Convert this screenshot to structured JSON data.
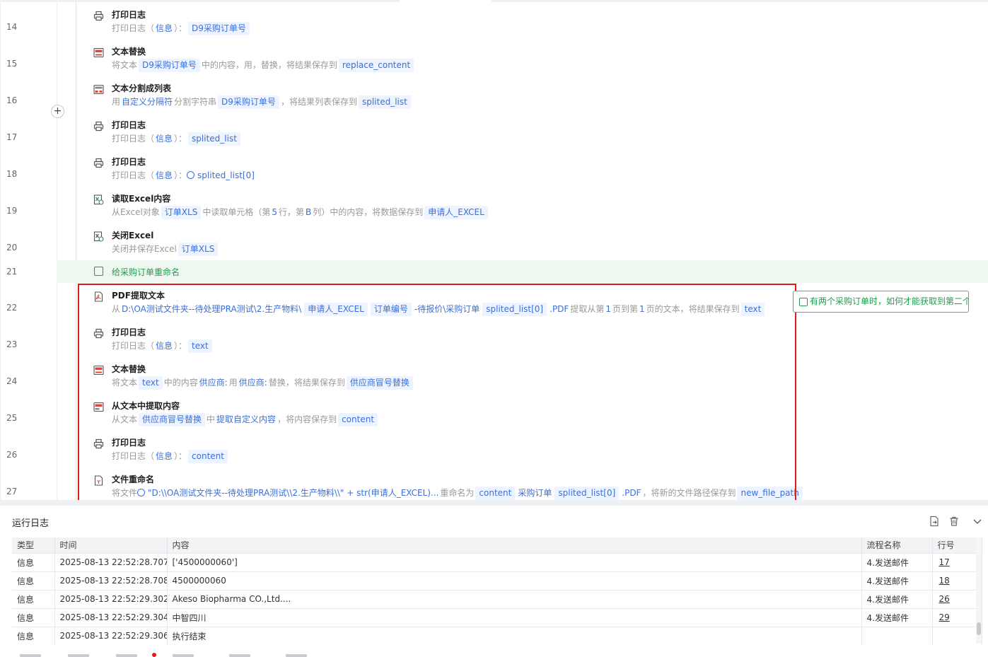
{
  "steps": [
    {
      "line": "14",
      "title": "打印日志",
      "icon": "printer-icon",
      "desc": [
        [
          "p",
          "打印日志（"
        ],
        [
          "l",
          "信息"
        ],
        [
          "p",
          "）："
        ],
        [
          "t",
          "D9采购订单号"
        ]
      ]
    },
    {
      "line": "15",
      "title": "文本替换",
      "icon": "text-replace-icon",
      "desc": [
        [
          "p",
          "将文本"
        ],
        [
          "t",
          "D9采购订单号"
        ],
        [
          "p",
          "中的内容，用，替换，将结果保存到"
        ],
        [
          "t",
          "replace_content"
        ]
      ]
    },
    {
      "line": "16",
      "title": "文本分割成列表",
      "icon": "text-split-icon",
      "desc": [
        [
          "p",
          "用"
        ],
        [
          "l",
          "自定义分隔符"
        ],
        [
          "p",
          "分割字符串"
        ],
        [
          "t",
          "D9采购订单号"
        ],
        [
          "p",
          "，将结果列表保存到"
        ],
        [
          "t",
          "splited_list"
        ]
      ]
    },
    {
      "line": "17",
      "title": "打印日志",
      "icon": "printer-icon",
      "desc": [
        [
          "p",
          "打印日志（"
        ],
        [
          "l",
          "信息"
        ],
        [
          "p",
          "）："
        ],
        [
          "t",
          "splited_list"
        ]
      ]
    },
    {
      "line": "18",
      "title": "打印日志",
      "icon": "printer-icon",
      "desc": [
        [
          "p",
          "打印日志（"
        ],
        [
          "l",
          "信息"
        ],
        [
          "p",
          "）："
        ],
        [
          "v",
          "splited_list[0]"
        ]
      ]
    },
    {
      "line": "19",
      "title": "读取Excel内容",
      "icon": "excel-read-icon",
      "desc": [
        [
          "p",
          "从Excel对象"
        ],
        [
          "t",
          "订单XLS"
        ],
        [
          "p",
          "中读取单元格（第"
        ],
        [
          "l",
          "5"
        ],
        [
          "p",
          "行，第"
        ],
        [
          "l",
          "B"
        ],
        [
          "p",
          "列）中的内容，将数据保存到"
        ],
        [
          "t",
          "申请人_EXCEL"
        ]
      ]
    },
    {
      "line": "20",
      "title": "关闭Excel",
      "icon": "excel-close-icon",
      "desc": [
        [
          "p",
          "关闭并保存Excel"
        ],
        [
          "t",
          "订单XLS"
        ]
      ]
    },
    {
      "line": "22",
      "title": "PDF提取文本",
      "icon": "pdf-icon",
      "desc": [
        [
          "p",
          "从"
        ],
        [
          "l",
          "D:\\OA测试文件夹--待处理PRA测试\\2.生产物料\\"
        ],
        [
          "t",
          "申请人_EXCEL"
        ],
        [
          "t",
          "订单编号"
        ],
        [
          "l",
          "-待报价\\采购订单"
        ],
        [
          "t",
          "splited_list[0]"
        ],
        [
          "l",
          ".PDF"
        ],
        [
          "p",
          "提取从第"
        ],
        [
          "l",
          "1"
        ],
        [
          "p",
          "页到第"
        ],
        [
          "l",
          "1"
        ],
        [
          "p",
          "页的文本，将结果保存到"
        ],
        [
          "t",
          "text"
        ]
      ]
    },
    {
      "line": "23",
      "title": "打印日志",
      "icon": "printer-icon",
      "desc": [
        [
          "p",
          "打印日志（"
        ],
        [
          "l",
          "信息"
        ],
        [
          "p",
          "）："
        ],
        [
          "t",
          "text"
        ]
      ]
    },
    {
      "line": "24",
      "title": "文本替换",
      "icon": "text-replace-icon",
      "desc": [
        [
          "p",
          "将文本"
        ],
        [
          "t",
          "text"
        ],
        [
          "p",
          "中的内容"
        ],
        [
          "l",
          "供应商:"
        ],
        [
          "p",
          "用"
        ],
        [
          "l",
          "供应商:"
        ],
        [
          "p",
          "替换，将结果保存到"
        ],
        [
          "t",
          "供应商冒号替换"
        ]
      ]
    },
    {
      "line": "25",
      "title": "从文本中提取内容",
      "icon": "text-extract-icon",
      "desc": [
        [
          "p",
          "从文本"
        ],
        [
          "t",
          "供应商冒号替换"
        ],
        [
          "p",
          "中"
        ],
        [
          "l",
          "提取自定义内容"
        ],
        [
          "p",
          "，将内容保存到"
        ],
        [
          "t",
          "content"
        ]
      ]
    },
    {
      "line": "26",
      "title": "打印日志",
      "icon": "printer-icon",
      "desc": [
        [
          "p",
          "打印日志（"
        ],
        [
          "l",
          "信息"
        ],
        [
          "p",
          "）："
        ],
        [
          "t",
          "content"
        ]
      ]
    },
    {
      "line": "27",
      "title": "文件重命名",
      "icon": "file-rename-icon",
      "desc": [
        [
          "p",
          "将文件"
        ],
        [
          "v",
          "\"D:\\\\OA测试文件夹--待处理PRA测试\\\\2.生产物料\\\\\" + str(申请人_EXCEL)..."
        ],
        [
          "p",
          "重命名为"
        ],
        [
          "t",
          "content"
        ],
        [
          "l",
          "采购订单"
        ],
        [
          "t",
          "splited_list[0]"
        ],
        [
          "l",
          ".PDF"
        ],
        [
          "p",
          "，将新的文件路径保存到"
        ],
        [
          "t",
          "new_file_path"
        ]
      ]
    }
  ],
  "comment": {
    "line": "21",
    "text": "给采购订单重命名"
  },
  "note": {
    "text": "有两个采购订单时，如何才能获取到第二个"
  },
  "log": {
    "title": "运行日志",
    "columns": [
      "类型",
      "时间",
      "内容",
      "流程名称",
      "行号"
    ],
    "rows": [
      {
        "type": "信息",
        "time": "2025-08-13 22:52:28.707",
        "content": "['4500000060']",
        "flow": "4.发送邮件",
        "line": "17"
      },
      {
        "type": "信息",
        "time": "2025-08-13 22:52:28.708",
        "content": "4500000060",
        "flow": "4.发送邮件",
        "line": "18"
      },
      {
        "type": "信息",
        "time": "2025-08-13 22:52:29.302",
        "content": "Akeso Biopharma CO.,Ltd....",
        "flow": "4.发送邮件",
        "line": "26"
      },
      {
        "type": "信息",
        "time": "2025-08-13 22:52:29.304",
        "content": " 中智四川",
        "flow": "4.发送邮件",
        "line": "29"
      },
      {
        "type": "信息",
        "time": "2025-08-13 22:52:29.306",
        "content": "执行结束",
        "flow": "",
        "line": ""
      }
    ]
  },
  "colors": {
    "accent": "#3b6fd9",
    "tag_bg": "#eef4ff",
    "comment_green": "#1f9d4d",
    "highlight_red": "#e01b1b"
  }
}
